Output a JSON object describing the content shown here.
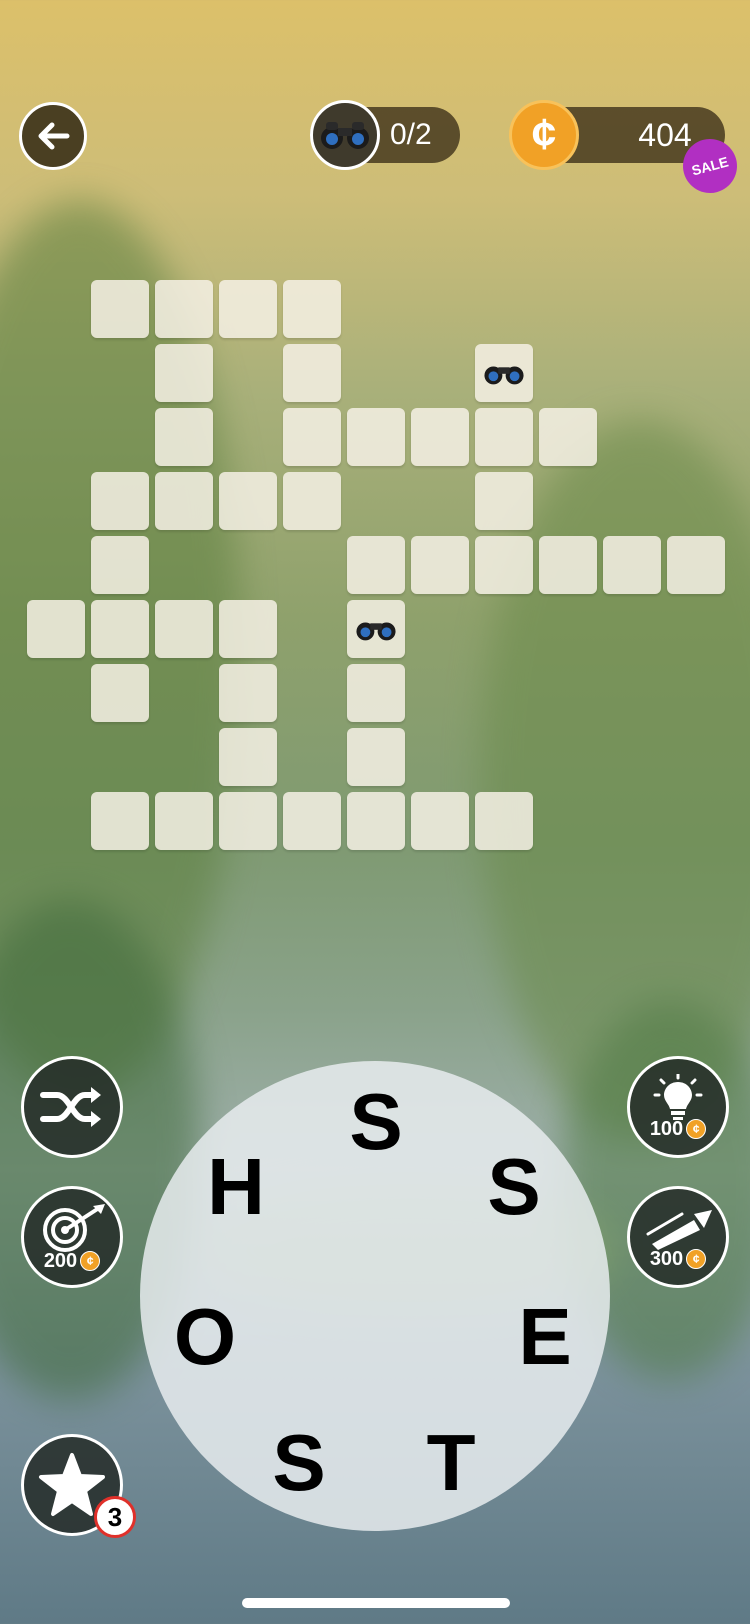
{
  "header": {
    "back_icon": "arrow-left-icon",
    "bonus_icon": "binoculars-icon",
    "bonus_words_found": "0/2",
    "coin_icon": "coin-icon",
    "coin_symbol": "¢",
    "coin_balance": "404",
    "sale_badge": "SALE"
  },
  "colors": {
    "tile": "#f5f0e4",
    "coin": "#f1a126",
    "sale": "#b12fc2",
    "button_bg": "#242c28"
  },
  "board": {
    "bonus_tiles": [
      "binoculars-icon",
      "binoculars-icon"
    ]
  },
  "tools": {
    "shuffle_icon": "shuffle-icon",
    "target_icon": "target-arrow-icon",
    "target_cost": "200",
    "hint_icon": "lightbulb-icon",
    "hint_cost": "100",
    "rocket_icon": "rocket-icon",
    "rocket_cost": "300",
    "star_icon": "star-icon",
    "star_count": "3",
    "coin_glyph": "¢"
  },
  "wheel": {
    "letters": [
      "S",
      "S",
      "E",
      "T",
      "S",
      "O",
      "H"
    ]
  }
}
